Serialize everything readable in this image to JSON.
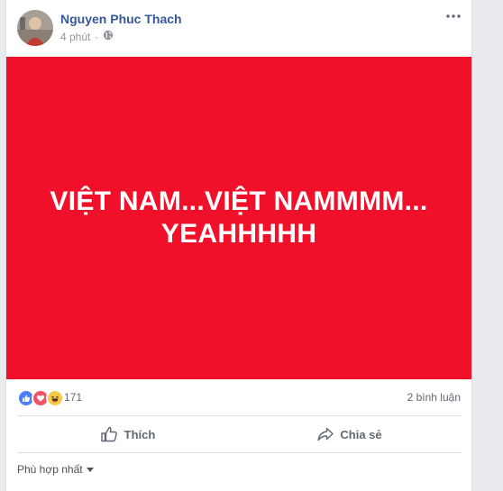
{
  "post": {
    "author": "Nguyen Phuc Thach",
    "time": "4 phút",
    "privacy_icon": "globe-icon",
    "banner": {
      "background": "#f1102a",
      "line1": "VIỆT NAM...VIỆT NAMMMM...",
      "line2": "YEAHHHHH"
    }
  },
  "reactions": {
    "icons": [
      "like-icon",
      "love-icon",
      "haha-icon"
    ],
    "count": "171",
    "comments": "2 bình luận"
  },
  "actions": {
    "like": "Thích",
    "share": "Chia sẻ"
  },
  "comments_sort": {
    "label": "Phù hợp nhất"
  },
  "colors": {
    "like_blue": "#4c7dfe",
    "love_red": "#f25268",
    "haha_yellow": "#f7c94a",
    "link_blue": "#365899"
  }
}
